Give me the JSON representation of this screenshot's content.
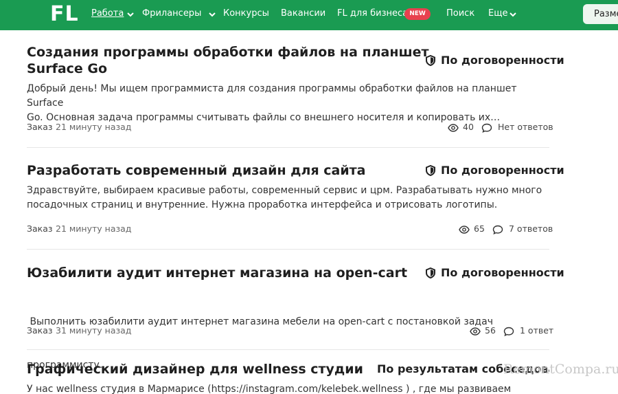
{
  "nav": {
    "logo": "FL",
    "items": [
      {
        "label": "Работа"
      },
      {
        "label": "Фрилансеры"
      },
      {
        "label": "Конкурсы"
      },
      {
        "label": "Вакансии"
      },
      {
        "label": "FL для бизнеса"
      },
      {
        "label": "Поиск"
      },
      {
        "label": "Еще"
      }
    ],
    "new_badge": "NEW",
    "place_button": "Разме"
  },
  "projects": [
    {
      "title_line1": "Создания программы обработки файлов на планшет",
      "title_line2": "Surface Go",
      "price": "По договоренности",
      "desc_line1": "Добрый день! Мы ищем программиста для создания программы обработки файлов на планшет Surface",
      "desc_line2": "Go. Основная задача программы считывать файлы со внешнего носителя и копировать их…",
      "type": "Заказ",
      "time": "21 минуту назад",
      "views": "40",
      "answers": "Нет ответов"
    },
    {
      "title_line1": "Разработать современный дизайн для сайта",
      "price": "По договоренности",
      "desc_line1": "Здравствуйте, выбираем красивые работы, современный сервис и црм. Разрабатывать нужно много",
      "desc_line2": "посадочных страниц и внутренние. Нужна проработка интерфейса и отрисовать логотипы.",
      "type": "Заказ",
      "time": "21 минуту назад",
      "views": "65",
      "answers": "7 ответов"
    },
    {
      "title_line1": "Юзабилити аудит интернет магазина на open-cart",
      "price": "По договоренности",
      "desc_line1": " Выполнить юзабилити аудит интернет магазина мебели на open-cart с постановкой задач",
      "desc_line2": "программисту.",
      "type": "Заказ",
      "time": "31 минуту назад",
      "views": "56",
      "answers": "1 ответ"
    },
    {
      "title_line1": "Графический дизайнер для wellness студии",
      "price": "По результатам собеседования",
      "desc_line1": "У нас wellness студия в Мармарисе (https://instagram.com/kelebek.wellness ) , где мы развиваем"
    }
  ],
  "watermark": "RemontCompa.ru",
  "colors": {
    "brand_green": "#1a9b52",
    "new_badge": "#e8414f"
  }
}
